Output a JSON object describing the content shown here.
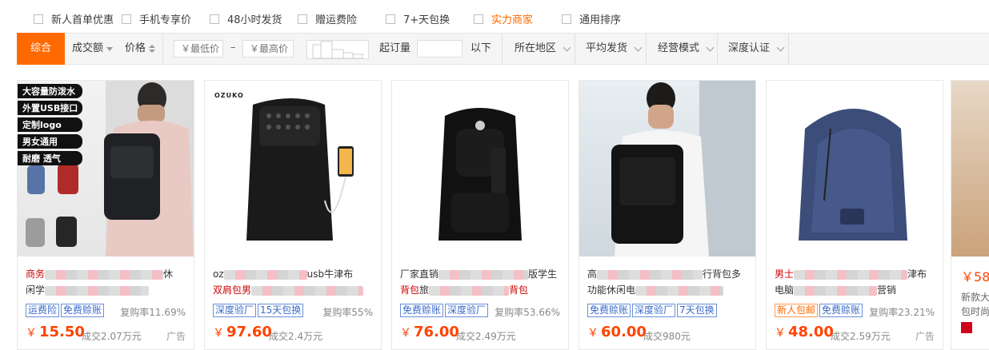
{
  "filters": [
    {
      "label": "新人首单优惠",
      "accent": false
    },
    {
      "label": "手机专享价",
      "accent": false
    },
    {
      "label": "48小时发货",
      "accent": false
    },
    {
      "label": "赠运费险",
      "accent": false
    },
    {
      "label": "7+天包换",
      "accent": false
    },
    {
      "label": "实力商家",
      "accent": true
    },
    {
      "label": "通用排序",
      "accent": false
    }
  ],
  "sort_bar": {
    "comprehensive": "综合",
    "volume": "成交额",
    "price": "价格",
    "min_price_placeholder": "￥最低价",
    "dash": "–",
    "max_price_placeholder": "￥最高价",
    "min_order_label": "起订量",
    "min_order_suffix": "以下",
    "region": "所在地区",
    "shipping": "平均发货",
    "business_mode": "经营模式",
    "certification": "深度认证"
  },
  "products": [
    {
      "title_line1_prefix": "商务",
      "title_line1_suffix": "休",
      "title_line2_prefix": "闲学",
      "title_line2_suffix": "",
      "tags": [
        {
          "label": "运费险",
          "style": "blue"
        },
        {
          "label": "免费赊账",
          "style": "blue"
        }
      ],
      "repurchase": "复购率11.69%",
      "price": "15.50",
      "sold": "成交2.07万元",
      "ad": "广告",
      "promo_labels": [
        "大容量防泼水",
        "外置USB接口",
        "定制logo",
        "男女通用",
        "耐磨 透气"
      ]
    },
    {
      "title_line1_prefix": "oz",
      "title_line1_suffix": "usb牛津布",
      "title_line2_prefix": "双肩包男",
      "title_line2_suffix": "",
      "tags": [
        {
          "label": "深度验厂",
          "style": "blue"
        },
        {
          "label": "15天包换",
          "style": "blue"
        }
      ],
      "repurchase": "复购率55%",
      "price": "97.60",
      "sold": "成交2.4万元",
      "ad": "",
      "brand": "OZUKO"
    },
    {
      "title_line1_prefix": "厂家直销",
      "title_line1_suffix": "版学生",
      "title_line2_prefix": "背包",
      "title_line2_mid": "旅",
      "title_line2_suffix": "背包",
      "tags": [
        {
          "label": "免费赊账",
          "style": "blue"
        },
        {
          "label": "深度验厂",
          "style": "blue"
        }
      ],
      "repurchase": "复购率53.66%",
      "price": "76.00",
      "sold": "成交2.49万元",
      "ad": ""
    },
    {
      "title_line1_prefix": "高",
      "title_line1_suffix": "行背包多",
      "title_line2_prefix": "功能休闲电",
      "title_line2_suffix": "",
      "tags": [
        {
          "label": "免费赊账",
          "style": "blue"
        },
        {
          "label": "深度验厂",
          "style": "blue"
        },
        {
          "label": "7天包换",
          "style": "blue"
        }
      ],
      "repurchase": "",
      "price": "60.00",
      "sold": "成交980元",
      "ad": ""
    },
    {
      "title_line1_prefix": "男士",
      "title_line1_suffix": "津布",
      "title_line2_prefix": "电脑",
      "title_line2_suffix": "营销",
      "tags": [
        {
          "label": "新人包邮",
          "style": "orange"
        },
        {
          "label": "免费赊账",
          "style": "blue"
        }
      ],
      "repurchase": "复购率23.21%",
      "price": "48.00",
      "sold": "成交2.59万元",
      "ad": "广告"
    }
  ],
  "partial_card": {
    "price_prefix": "￥",
    "price_visible": "58",
    "title_line1": "新款大",
    "title_line2": "包时尚"
  },
  "colors": {
    "accent": "#ff6a00",
    "price": "#ff4400",
    "tag_blue": "#3a6bc9",
    "title_red": "#cc0000"
  }
}
